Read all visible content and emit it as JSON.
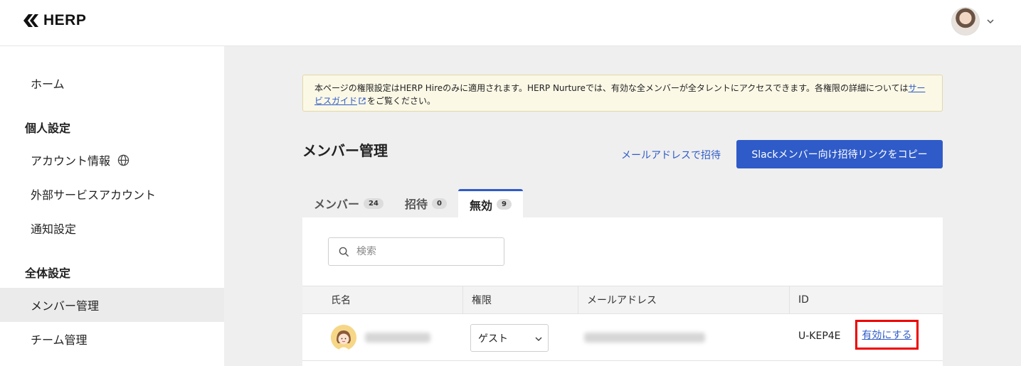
{
  "header": {
    "brand": "HERP"
  },
  "sidebar": {
    "home": "ホーム",
    "personal_heading": "個人設定",
    "account_info": "アカウント情報",
    "external_accounts": "外部サービスアカウント",
    "notifications": "通知設定",
    "global_heading": "全体設定",
    "member_management": "メンバー管理",
    "team_management": "チーム管理"
  },
  "notice": {
    "text_before_link": "本ページの権限設定はHERP Hireのみに適用されます。HERP Nurtureでは、有効な全メンバーが全タレントにアクセスできます。各権限の詳細については",
    "link_text": "サービスガイド",
    "text_after_link": "をご覧ください。"
  },
  "main": {
    "title": "メンバー管理",
    "invite_by_email": "メールアドレスで招待",
    "copy_slack_link": "Slackメンバー向け招待リンクをコピー"
  },
  "tabs": [
    {
      "label": "メンバー",
      "count": "24"
    },
    {
      "label": "招待",
      "count": "0"
    },
    {
      "label": "無効",
      "count": "9"
    }
  ],
  "search": {
    "placeholder": "検索"
  },
  "table": {
    "columns": [
      "氏名",
      "権限",
      "メールアドレス",
      "ID"
    ],
    "rows": [
      {
        "role": "ゲスト",
        "id": "U-KEP4E",
        "action": "有効にする"
      }
    ]
  },
  "colors": {
    "accent": "#2f5bc8",
    "highlight": "#e00000",
    "notice_bg": "#fbf8e6"
  }
}
